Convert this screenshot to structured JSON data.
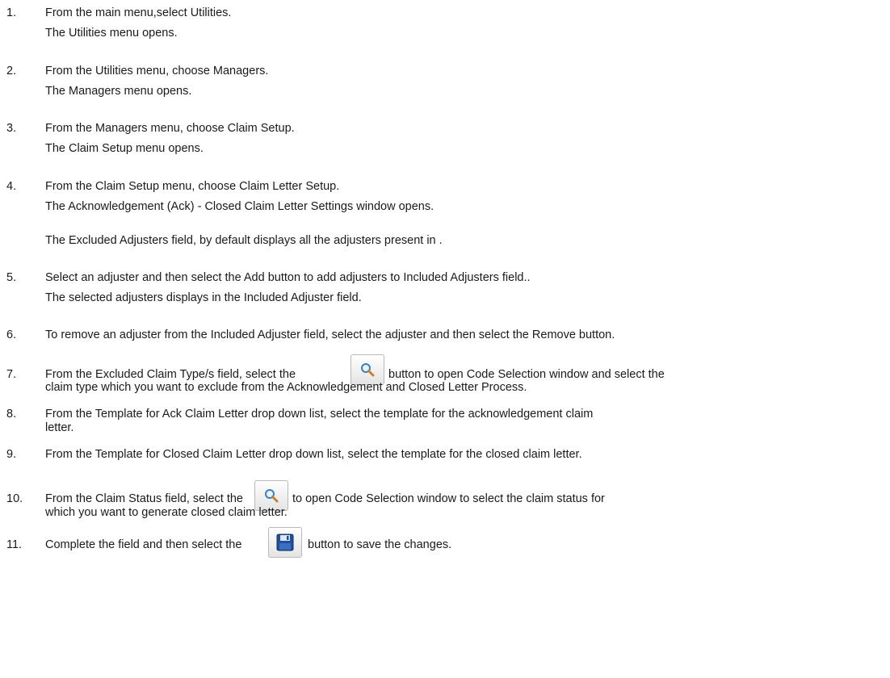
{
  "steps": [
    {
      "num": "1.",
      "text": "From the main menu,select Utilities.",
      "result": "The Utilities menu opens."
    },
    {
      "num": "2.",
      "text": "From the Utilities menu, choose Managers.",
      "result": "The Managers menu opens."
    },
    {
      "num": "3.",
      "text": "From the Managers menu, choose Claim Setup.",
      "result": "The Claim Setup menu opens."
    },
    {
      "num": "4.",
      "text": "From the Claim Setup menu, choose Claim Letter Setup.",
      "result": "The Acknowledgement (Ack) - Closed Claim Letter Settings window opens.",
      "note": "The Excluded Adjusters field, by default displays all the adjusters present in ."
    },
    {
      "num": "5.",
      "text": "Select an adjuster and then select the Add button to add adjusters to Included Adjusters field..",
      "result": "The selected adjusters displays in the Included Adjuster field."
    },
    {
      "num": "6.",
      "text": "To remove an adjuster from the Included Adjuster field, select the adjuster and then select the Remove button."
    },
    {
      "num": "7.",
      "text_before": "From the Excluded Claim Type/s field, select the",
      "text_after": "button to open Code Selection window and select the",
      "text_line2": "claim  type which you want to exclude from the Acknowledgement and Closed Letter Process."
    },
    {
      "num": "8.",
      "text": "From the Template for Ack Claim Letter drop down list, select the template for the acknowledgement claim",
      "text_line2": "letter."
    },
    {
      "num": "9.",
      "text": "From the Template for Closed Claim Letter drop down list, select the template for the closed claim letter."
    },
    {
      "num": "10.",
      "text_before": "From the Claim Status field, select the",
      "text_after": "to open Code Selection window to select the claim status for",
      "text_line2": "which you want to generate closed claim letter."
    },
    {
      "num": "11.",
      "text_before": "Complete the field and then select the",
      "text_after": "button to save the changes."
    }
  ],
  "icons": {
    "search": "magnifier-icon",
    "save": "floppy-disk-icon"
  }
}
